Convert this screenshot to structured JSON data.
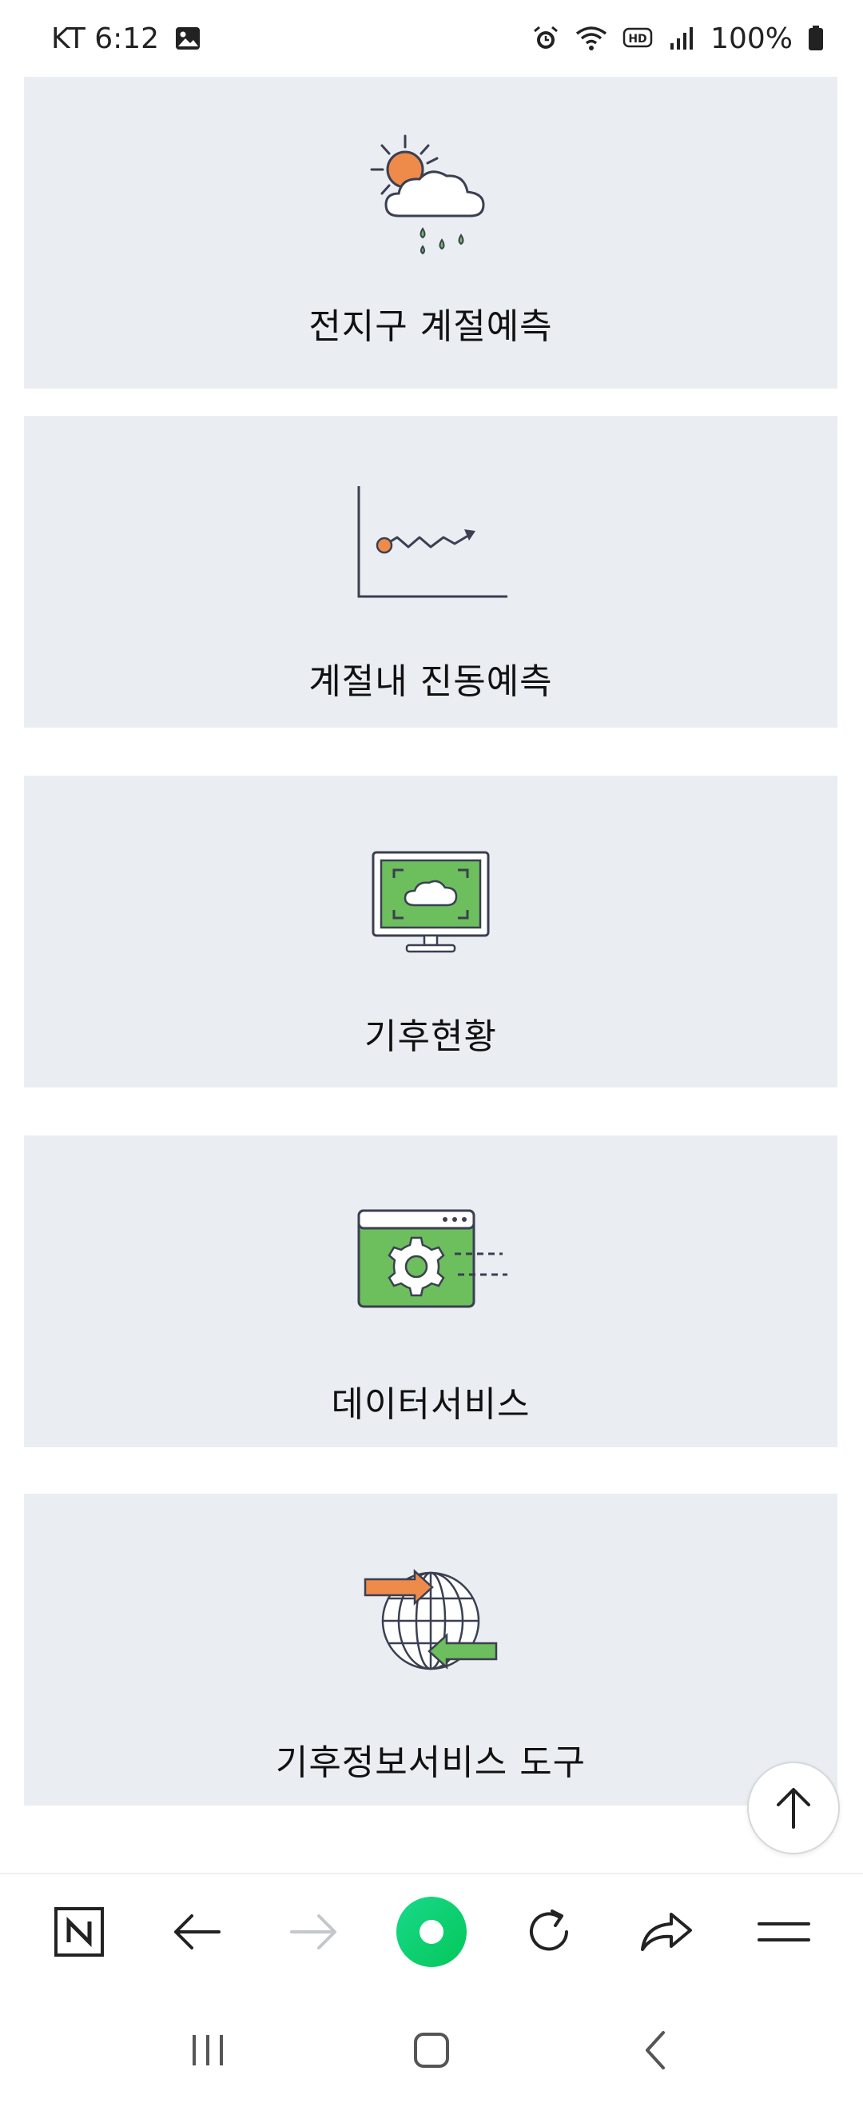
{
  "status_bar": {
    "carrier_time": "KT 6:12",
    "battery": "100%"
  },
  "cards": [
    {
      "label": "전지구 계절예측",
      "icon": "sun-cloud-rain-icon"
    },
    {
      "label": "계절내 진동예측",
      "icon": "trend-chart-icon"
    },
    {
      "label": "기후현황",
      "icon": "monitor-cloud-icon"
    },
    {
      "label": "데이터서비스",
      "icon": "browser-gear-icon"
    },
    {
      "label": "기후정보서비스 도구",
      "icon": "globe-arrows-icon"
    }
  ],
  "toolbar": {
    "items": [
      "naver-home-icon",
      "back-arrow-icon",
      "forward-arrow-icon",
      "green-dot-icon",
      "refresh-icon",
      "share-icon",
      "menu-icon"
    ]
  },
  "colors": {
    "card_bg": "#eaeef2",
    "accent_green": "#6cbf5c",
    "accent_orange": "#ee8b4a",
    "naver_green": "#03c75a"
  }
}
